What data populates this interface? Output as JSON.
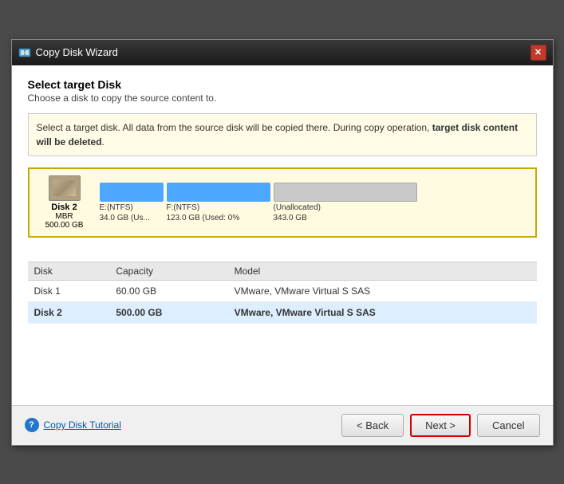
{
  "window": {
    "title": "Copy Disk Wizard",
    "close_label": "✕"
  },
  "header": {
    "step_title": "Select target Disk",
    "step_subtitle": "Choose a disk to copy the source content to."
  },
  "info_box": {
    "text_part1": "Select a target disk. All data from the source disk will be copied there. During copy operation, ",
    "text_bold": "target disk content will be deleted",
    "text_part2": "."
  },
  "disk_visual": {
    "label": "Disk 2",
    "type": "MBR",
    "size": "500.00 GB",
    "partitions": [
      {
        "name": "E:(NTFS)",
        "detail": "34.0 GB (Us..."
      },
      {
        "name": "F:(NTFS)",
        "detail": "123.0 GB (Used: 0%"
      },
      {
        "name": "(Unallocated)",
        "detail": "343.0 GB"
      }
    ]
  },
  "table": {
    "columns": [
      "Disk",
      "Capacity",
      "Model"
    ],
    "rows": [
      {
        "disk": "Disk 1",
        "capacity": "60.00 GB",
        "model": "VMware, VMware Virtual S SAS",
        "selected": false
      },
      {
        "disk": "Disk 2",
        "capacity": "500.00 GB",
        "model": "VMware, VMware Virtual S SAS",
        "selected": true
      }
    ]
  },
  "footer": {
    "help_link": "Copy Disk Tutorial",
    "back_label": "< Back",
    "next_label": "Next >",
    "cancel_label": "Cancel"
  }
}
